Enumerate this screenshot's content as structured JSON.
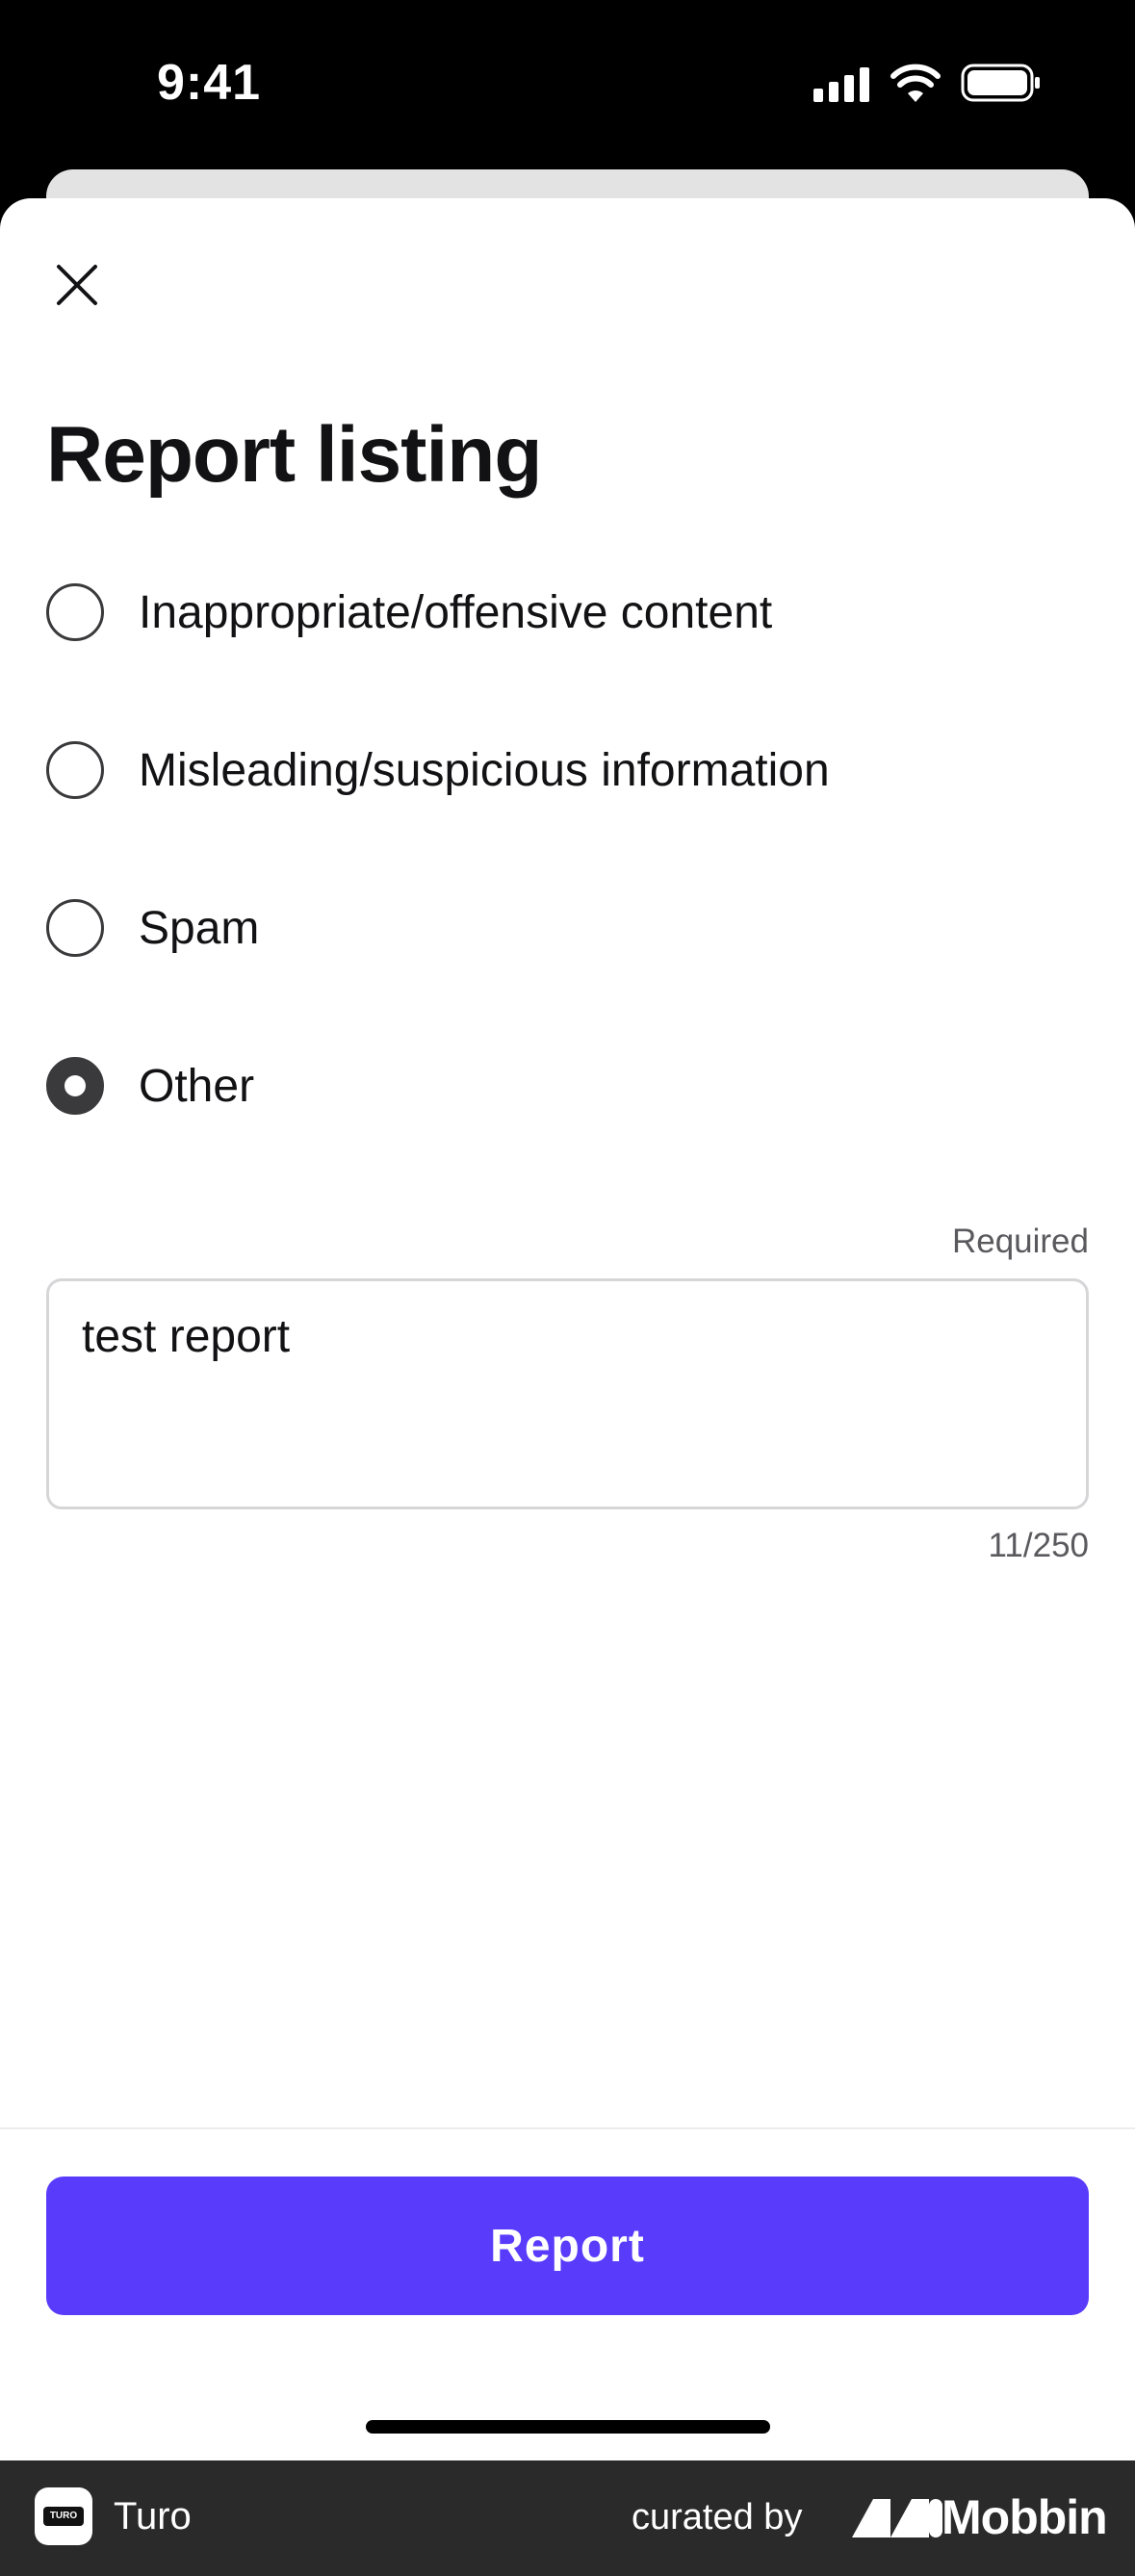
{
  "status_bar": {
    "time": "9:41"
  },
  "sheet": {
    "title": "Report listing",
    "options": [
      {
        "label": "Inappropriate/offensive content",
        "selected": false
      },
      {
        "label": "Misleading/suspicious information",
        "selected": false
      },
      {
        "label": "Spam",
        "selected": false
      },
      {
        "label": "Other",
        "selected": true
      }
    ],
    "details": {
      "required_label": "Required",
      "value": "test report",
      "counter": "11/250"
    },
    "submit_label": "Report",
    "accent_color": "#593cfb"
  },
  "footer": {
    "app_name": "Turo",
    "app_icon_text": "TURO",
    "curated_by": "curated by",
    "brand": "Mobbin"
  }
}
